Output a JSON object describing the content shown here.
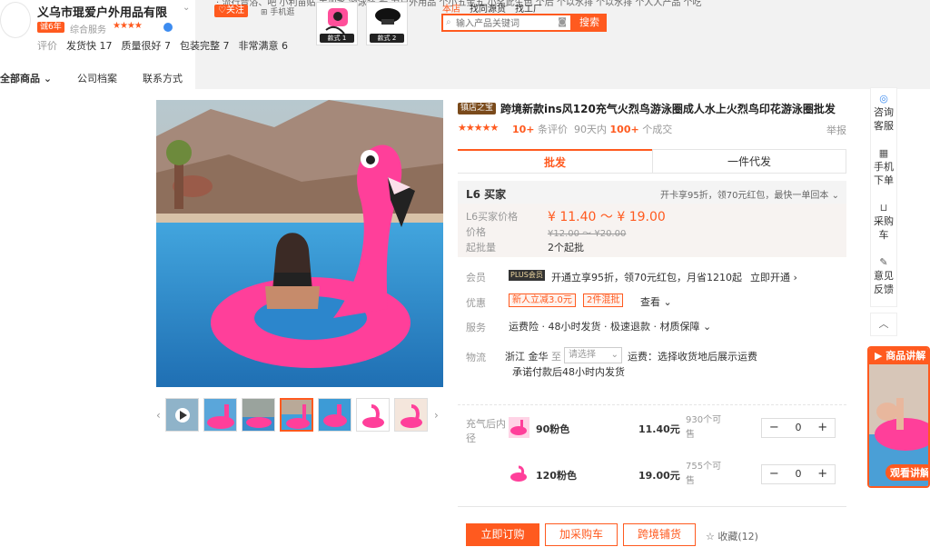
{
  "shop": {
    "name": "义乌市琨爱户外用品有限",
    "years_badge": "诚6年",
    "service_label": "综合服务",
    "service_stars": "★★★★",
    "ratings_label": "评价",
    "rating1": "发货快 17",
    "rating2": "质量很好 7",
    "rating3": "包装完整 7",
    "rating4": "非常满意 6",
    "follow": "♡关注",
    "mobile": "⊞ 手机逛",
    "top_links": "· 流行音浴、吧  小利苗贴  手加水  游泳装  长  为户外用品  个小五金五  小奖此生色  个后  个以水排  个以水排  个人人产品  个吃",
    "thumb1_label": "款式 1",
    "thumb2_label": "款式 2"
  },
  "search": {
    "tab1": "本店",
    "tab2": "找同源货",
    "tab3": "找工厂",
    "placeholder": "输入产品关键词",
    "button": "搜索"
  },
  "shopnav": [
    "全部商品 ⌄",
    "公司档案",
    "联系方式"
  ],
  "product": {
    "store_badge": "镇店之宝",
    "title": "跨境新款ins风120充气火烈鸟游泳圈成人水上火烈鸟印花游泳圈批发",
    "stars": "★★★★★",
    "review_count": "10+",
    "review_text": "条评价",
    "sold_prefix": "90天内",
    "sold_count": "100+",
    "sold_suffix": "个成交",
    "report": "举报"
  },
  "tabs": {
    "wholesale": "批发",
    "dropship": "一件代发"
  },
  "price": {
    "l6_title": "L6 买家",
    "l6_note": "开卡享95折，领70元红包，最快一单回本 ⌄",
    "l6_price_label": "L6买家价格",
    "l6_price": "¥ 11.40 ～ ¥ 19.00",
    "price_label": "价格",
    "orig_price": "¥12.00 ～ ¥20.00",
    "moq_label": "起批量",
    "moq": "2个起批"
  },
  "member": {
    "label": "会员",
    "badge": "PLUS会员",
    "text": "开通立享95折，领70元红包，月省1210起",
    "link": "立即开通 ›"
  },
  "promo": {
    "label": "优惠",
    "coupon1": "新人立减3.0元",
    "coupon2": "2件混批",
    "more": "查看 ⌄"
  },
  "service": {
    "label": "服务",
    "text": "运费险 · 48小时发货 · 极速退款 · 材质保障 ⌄"
  },
  "logistics": {
    "label": "物流",
    "origin": "浙江 金华",
    "to": "至",
    "select": "请选择",
    "fee": "运费：选择收货地后展示运费",
    "promise": "承诺付款后48小时内发货"
  },
  "sku": {
    "label": "充气后内径",
    "items": [
      {
        "name": "90粉色",
        "price": "11.40元",
        "stock": "930个可售",
        "qty": "0"
      },
      {
        "name": "120粉色",
        "price": "19.00元",
        "stock": "755个可售",
        "qty": "0"
      }
    ]
  },
  "actions": {
    "buy": "立即订购",
    "cart": "加采购车",
    "cross": "跨境铺货",
    "fav": "☆ 收藏(12)"
  },
  "sidebar": {
    "consult": "咨询客服",
    "phone": "手机下单",
    "cart": "采购车",
    "feedback": "意见反馈"
  },
  "video": {
    "head": "▶ 商品讲解",
    "foot": "观看讲解"
  },
  "colors": {
    "accent": "#ff5a1f",
    "flamingo": "#ff3f9a",
    "water": "#2f8fd6"
  }
}
